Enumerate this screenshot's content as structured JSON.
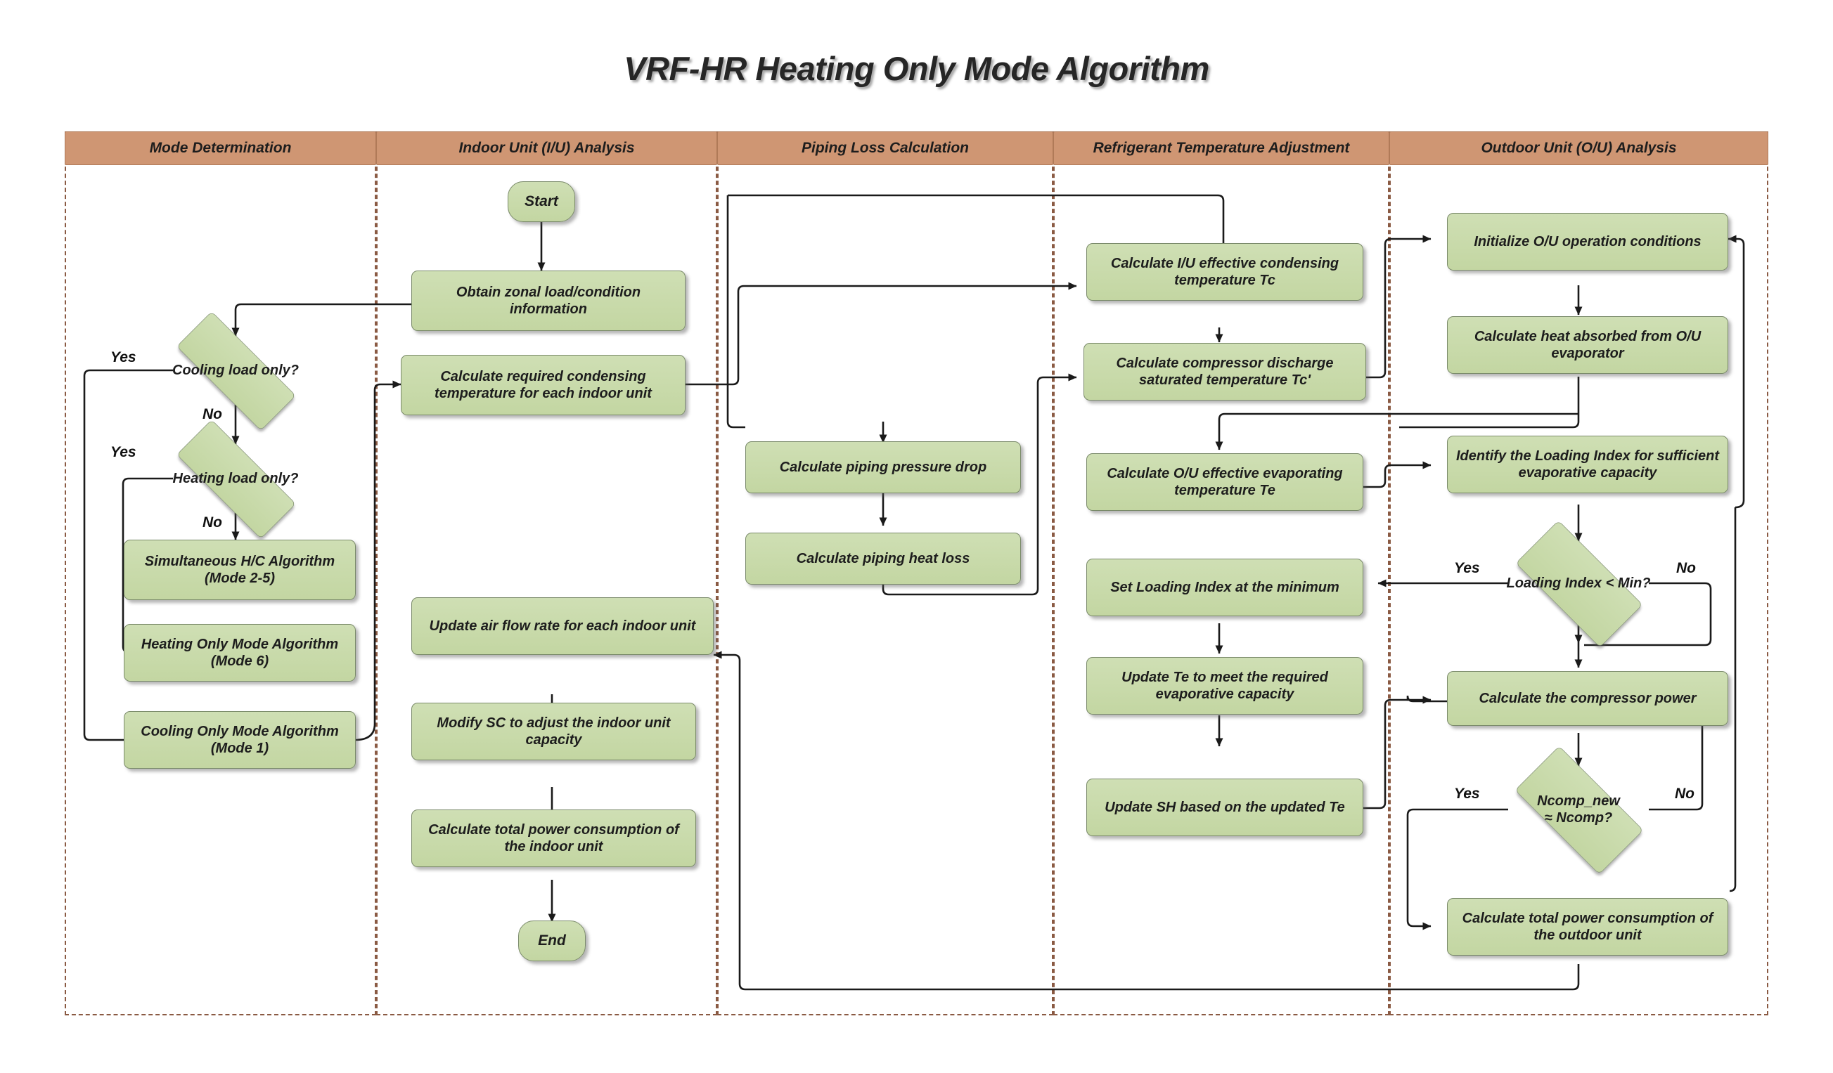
{
  "title": "VRF-HR Heating Only Mode Algorithm",
  "lanes": [
    {
      "id": "mode-determination",
      "label": "Mode Determination"
    },
    {
      "id": "indoor-unit-analysis",
      "label": "Indoor Unit (I/U) Analysis"
    },
    {
      "id": "piping-loss-calculation",
      "label": "Piping Loss Calculation"
    },
    {
      "id": "refrigerant-temperature-adjustment",
      "label": "Refrigerant Temperature Adjustment"
    },
    {
      "id": "outdoor-unit-analysis",
      "label": "Outdoor Unit (O/U) Analysis"
    }
  ],
  "nodes": {
    "start": "Start",
    "end": "End",
    "obtain_zonal": "Obtain zonal load/condition information",
    "calc_required_cond": "Calculate required condensing temperature for each indoor unit",
    "update_air_flow": "Update air flow rate for each indoor unit",
    "modify_sc": "Modify SC to adjust the indoor unit capacity",
    "calc_total_power_iu": "Calculate total power consumption of the indoor unit",
    "cooling_load_only": "Cooling load only?",
    "heating_load_only": "Heating load only?",
    "simultaneous_hc": "Simultaneous H/C Algorithm (Mode 2-5)",
    "heating_only_mode": "Heating Only Mode Algorithm (Mode 6)",
    "cooling_only_mode": "Cooling Only Mode Algorithm (Mode 1)",
    "calc_piping_pressure_drop": "Calculate piping pressure drop",
    "calc_piping_heat_loss": "Calculate piping  heat loss",
    "calc_iu_tc": "Calculate I/U effective condensing temperature Tc",
    "calc_compressor_tcp": "Calculate compressor discharge saturated temperature Tc'",
    "calc_ou_te": "Calculate O/U effective evaporating temperature Te",
    "set_loading_index_min": "Set Loading Index at the minimum",
    "update_te": "Update Te to meet the required evaporative capacity",
    "update_sh": "Update SH based on the updated Te",
    "init_ou": "Initialize O/U operation conditions",
    "calc_heat_absorbed": "Calculate heat absorbed from O/U evaporator",
    "identify_loading_index": "Identify the Loading Index for sufficient evaporative capacity",
    "loading_index_min": "Loading Index < Min?",
    "calc_compressor_power": "Calculate the compressor power",
    "ncomp_check": "Ncomp_new ≈  Ncomp?",
    "ncomp_check_l1": "Ncomp_new",
    "ncomp_check_l2": "≈  Ncomp?",
    "calc_total_power_ou": "Calculate total power consumption of the outdoor unit"
  },
  "edge_labels": {
    "cooling_yes": "Yes",
    "cooling_no": "No",
    "heating_yes": "Yes",
    "heating_no": "No",
    "loading_yes": "Yes",
    "loading_no": "No",
    "ncomp_yes": "Yes",
    "ncomp_no": "No"
  },
  "colors": {
    "lane_header": "#cf9673",
    "lane_border": "#8a5a43",
    "node_fill": "#c5d9a5",
    "node_border": "#7a8a6a",
    "text": "#1d1d1d",
    "wire": "#1a1a1a"
  }
}
